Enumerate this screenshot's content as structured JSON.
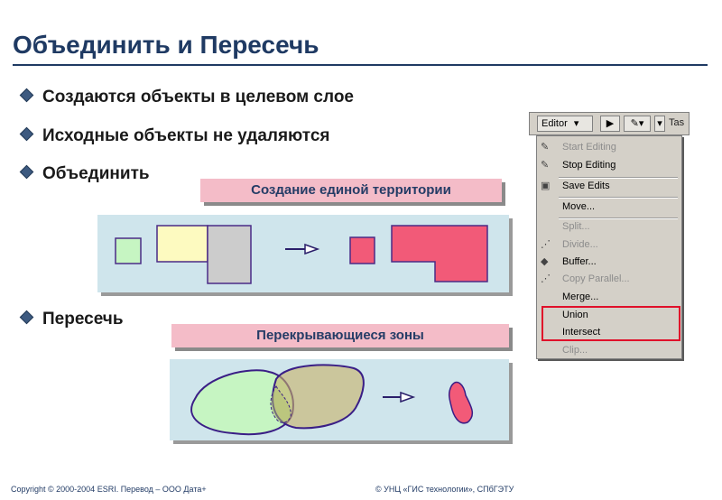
{
  "title": "Объединить и Пересечь",
  "bullets": [
    "Создаются объекты в целевом слое",
    "Исходные объекты не удаляются",
    "Объединить",
    "Пересечь"
  ],
  "banners": {
    "union": "Создание единой территории",
    "intersect": "Перекрывающиеся зоны"
  },
  "toolbar": {
    "editor_label": "Editor",
    "task_label": "Tas"
  },
  "menu_items": [
    {
      "label": "Start Editing",
      "enabled": false,
      "icon": "pencil-start-icon"
    },
    {
      "label": "Stop Editing",
      "enabled": true,
      "icon": "pencil-stop-icon"
    },
    {
      "label": "Save Edits",
      "enabled": true,
      "icon": "save-edits-icon"
    },
    {
      "label": "Move...",
      "enabled": true,
      "icon": ""
    },
    {
      "label": "Split...",
      "enabled": false,
      "icon": ""
    },
    {
      "label": "Divide...",
      "enabled": false,
      "icon": "divide-icon"
    },
    {
      "label": "Buffer...",
      "enabled": true,
      "icon": "buffer-icon"
    },
    {
      "label": "Copy Parallel...",
      "enabled": false,
      "icon": "copy-parallel-icon"
    },
    {
      "label": "Merge...",
      "enabled": true,
      "icon": ""
    },
    {
      "label": "Union",
      "enabled": true,
      "icon": ""
    },
    {
      "label": "Intersect",
      "enabled": true,
      "icon": ""
    },
    {
      "label": "Clip...",
      "enabled": false,
      "icon": ""
    }
  ],
  "footer": {
    "left": "Copyright © 2000-2004 ESRI. Перевод  – ООО Дата+",
    "right": "© УНЦ «ГИС технологии», СПбГЭТУ"
  },
  "colors": {
    "title": "#1f3a63",
    "banner": "#f4bcc8",
    "panel": "#cfe5ec",
    "result_fill": "#f25a78",
    "highlight": "#e0102a"
  }
}
